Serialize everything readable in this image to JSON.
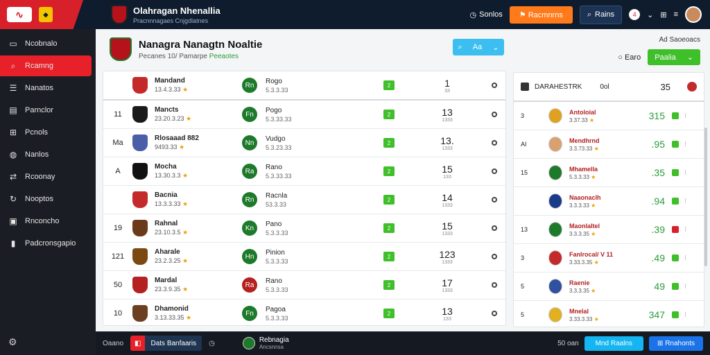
{
  "header_bar": {
    "club_name": "Olahragan Nhenallia",
    "club_sub": "Pracnnnagaes    Cnjgdlatnes",
    "link_1": "Sonlos",
    "orange_btn": "Racmnrns",
    "search_btn": "Rains",
    "notification_count": "4"
  },
  "sidebar": {
    "items": [
      {
        "label": "Ncobnalo",
        "icon": "monitor-icon"
      },
      {
        "label": "Rcamng",
        "icon": "search-icon"
      },
      {
        "label": "Nanatos",
        "icon": "list-icon"
      },
      {
        "label": "Parnclor",
        "icon": "calendar-icon"
      },
      {
        "label": "Pcnols",
        "icon": "plus-icon"
      },
      {
        "label": "Nanlos",
        "icon": "globe-icon"
      },
      {
        "label": "Rcoonay",
        "icon": "shuffle-icon"
      },
      {
        "label": "Nooptos",
        "icon": "refresh-icon"
      },
      {
        "label": "Rnconcho",
        "icon": "doc-icon"
      },
      {
        "label": "Padcronsgapio",
        "icon": "chart-icon"
      }
    ],
    "active_index": 1
  },
  "main": {
    "title": "Nanagra Nanagtn Noaltie",
    "subtitle_a": "Pecanes 10/ Pamarpe",
    "subtitle_b": "Peeaotes",
    "filter_label": "Aa",
    "hint_text": "Ad Saoeoacs",
    "radio_label": "Earo",
    "green_btn": "Paalia"
  },
  "fixtures": [
    {
      "num": "",
      "team": "Mandand",
      "date": "13.4.3.33",
      "opp_icon": "Rn",
      "opp": "Rogo",
      "opp_date": "5.3.3.33",
      "chip": "2",
      "score": "1",
      "score_sub": "33"
    },
    {
      "num": "11",
      "team": "Mancts",
      "date": "23.20.3.23",
      "opp_icon": "Fn",
      "opp": "Pogo",
      "opp_date": "5.3.33.33",
      "chip": "2",
      "score": "13",
      "score_sub": "1333"
    },
    {
      "num": "Ma",
      "team": "Rlosaaad 882",
      "date": "9493.33",
      "opp_icon": "Nn",
      "opp": "Vudgo",
      "opp_date": "5.3.23.33",
      "chip": "2",
      "score": "13.",
      "score_sub": "1333"
    },
    {
      "num": "A",
      "team": "Mocha",
      "date": "13.30.3.3",
      "opp_icon": "Ra",
      "opp": "Rano",
      "opp_date": "5.3.33.33",
      "chip": "2",
      "score": "15",
      "score_sub": "133"
    },
    {
      "num": "",
      "team": "Bacnia",
      "date": "13.3.3.33",
      "opp_icon": "Rn",
      "opp": "Racnla",
      "opp_date": "53.3.33",
      "chip": "2",
      "score": "14",
      "score_sub": "1333"
    },
    {
      "num": "19",
      "team": "Rahnal",
      "date": "23.10.3.5",
      "opp_icon": "Kn",
      "opp": "Pano",
      "opp_date": "5.3.3.33",
      "chip": "2",
      "score": "15",
      "score_sub": "1333"
    },
    {
      "num": "121",
      "team": "Aharale",
      "date": "23.2.3.25",
      "opp_icon": "Hn",
      "opp": "Pinion",
      "opp_date": "5.3.3.33",
      "chip": "2",
      "score": "123",
      "score_sub": "1333"
    },
    {
      "num": "50",
      "team": "Mardal",
      "date": "23.3.9.35",
      "opp_icon": "Ra",
      "opp": "Rano",
      "opp_date": "5.3.3.33",
      "chip": "2",
      "score": "17",
      "score_sub": "1333"
    },
    {
      "num": "10",
      "team": "Dhamonid",
      "date": "3.13.33.35",
      "opp_icon": "Fn",
      "opp": "Pagoa",
      "opp_date": "5.3.3.33",
      "chip": "2",
      "score": "13",
      "score_sub": "133"
    }
  ],
  "standings_head": {
    "code": "DARAHESTRK",
    "tag": "0ol",
    "value": "35"
  },
  "standings": [
    {
      "pos": "3",
      "team": "Antoloial",
      "date": "3.37.33",
      "pts": "315"
    },
    {
      "pos": "AI",
      "team": "Mendhrnd",
      "date": "3.3.73.33",
      "pts": ".95"
    },
    {
      "pos": "15",
      "team": "Mhamella",
      "date": "5.3.3.33",
      "pts": ".35"
    },
    {
      "pos": "",
      "team": "Naaonaclh",
      "date": "3.3.3.33",
      "pts": ".94"
    },
    {
      "pos": "13",
      "team": "Maonlaltel",
      "date": "3.3.3.35",
      "pts": ".39"
    },
    {
      "pos": "3",
      "team": "Fanlrocal/ V 11",
      "date": "3.33.3.35",
      "pts": ".49"
    },
    {
      "pos": "5",
      "team": "Raenie",
      "date": "3.3.3.35",
      "pts": "49"
    },
    {
      "pos": "5",
      "team": "Mnelal",
      "date": "3.33.3.33",
      "pts": "347"
    }
  ],
  "bottom": {
    "left_text": "Oaano",
    "red_btn": "Dats Banfaaris",
    "player_name": "Rebnagia",
    "player_sub": "Ancsnnsa",
    "count": "50 oan",
    "cyan_btn": "Mnd Raalns",
    "blue_btn": "Rnahonts"
  },
  "colors": {
    "accent_red": "#e8202a",
    "accent_green": "#3fbf2a",
    "accent_orange": "#ff7a1a",
    "nav_dark": "#0f1c2e"
  }
}
